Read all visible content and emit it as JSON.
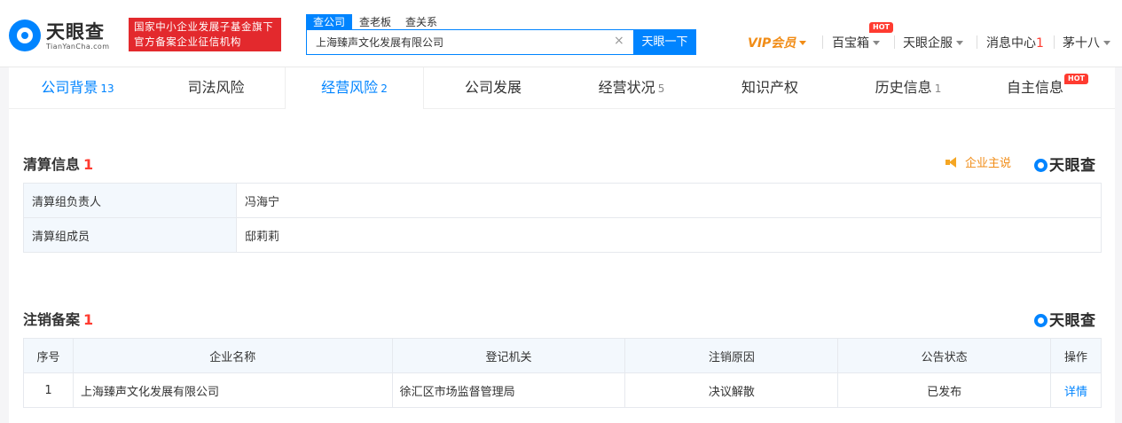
{
  "header": {
    "logo_name": "天眼查",
    "logo_domain": "TianYanCha.com",
    "badge_line1": "国家中小企业发展子基金旗下",
    "badge_line2": "官方备案企业征信机构",
    "search_tabs": [
      "查公司",
      "查老板",
      "查关系"
    ],
    "search_value": "上海臻声文化发展有限公司",
    "search_clear": "×",
    "search_button": "天眼一下",
    "vip": "VIP会员",
    "baobao": "百宝箱",
    "hot1": "HOT",
    "qifu": "天眼企服",
    "msg_label": "消息中心",
    "msg_count": "1",
    "user": "茅十八"
  },
  "tabs": [
    {
      "label": "公司背景",
      "count": "13"
    },
    {
      "label": "司法风险",
      "count": ""
    },
    {
      "label": "经营风险",
      "count": "2"
    },
    {
      "label": "公司发展",
      "count": ""
    },
    {
      "label": "经营状况",
      "count": "5"
    },
    {
      "label": "知识产权",
      "count": ""
    },
    {
      "label": "历史信息",
      "count": "1"
    },
    {
      "label": "自主信息",
      "count": ""
    }
  ],
  "tab_hot": "HOT",
  "liquidation": {
    "title": "清算信息",
    "count": "1",
    "ent_say": "企业主说",
    "brand": "天眼查",
    "rows": [
      {
        "key": "清算组负责人",
        "value": "冯海宁"
      },
      {
        "key": "清算组成员",
        "value": "邸莉莉"
      }
    ]
  },
  "cancellation": {
    "title": "注销备案",
    "count": "1",
    "brand": "天眼查",
    "headers": [
      "序号",
      "企业名称",
      "登记机关",
      "注销原因",
      "公告状态",
      "操作"
    ],
    "rows": [
      {
        "no": "1",
        "name": "上海臻声文化发展有限公司",
        "authority": "徐汇区市场监督管理局",
        "reason": "决议解散",
        "status": "已发布",
        "action": "详情"
      }
    ]
  },
  "colors": {
    "brand_blue": "#0084ff",
    "badge_red": "#e3292d",
    "vip_orange": "#f18c16"
  }
}
